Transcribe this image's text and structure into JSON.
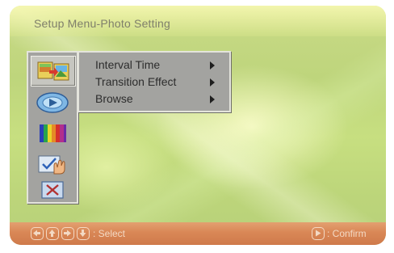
{
  "title": "Setup Menu-Photo Setting",
  "sidebar": {
    "items": [
      {
        "icon": "photo-setting-icon",
        "selected": true
      },
      {
        "icon": "video-disc-icon",
        "selected": false
      },
      {
        "icon": "color-bars-icon",
        "selected": false
      },
      {
        "icon": "hand-check-icon",
        "selected": false
      },
      {
        "icon": "exit-icon",
        "selected": false
      }
    ]
  },
  "submenu": {
    "items": [
      {
        "label": "Interval Time"
      },
      {
        "label": "Transition Effect"
      },
      {
        "label": "Browse"
      }
    ]
  },
  "footer": {
    "nav_keys": [
      "left-arrow-key",
      "up-arrow-key",
      "right-arrow-key",
      "down-arrow-key"
    ],
    "select_label": ": Select",
    "confirm_label": ": Confirm"
  },
  "colors": {
    "background": "#c4da80",
    "panel": "#a3a3a0",
    "footer": "#d98756"
  }
}
